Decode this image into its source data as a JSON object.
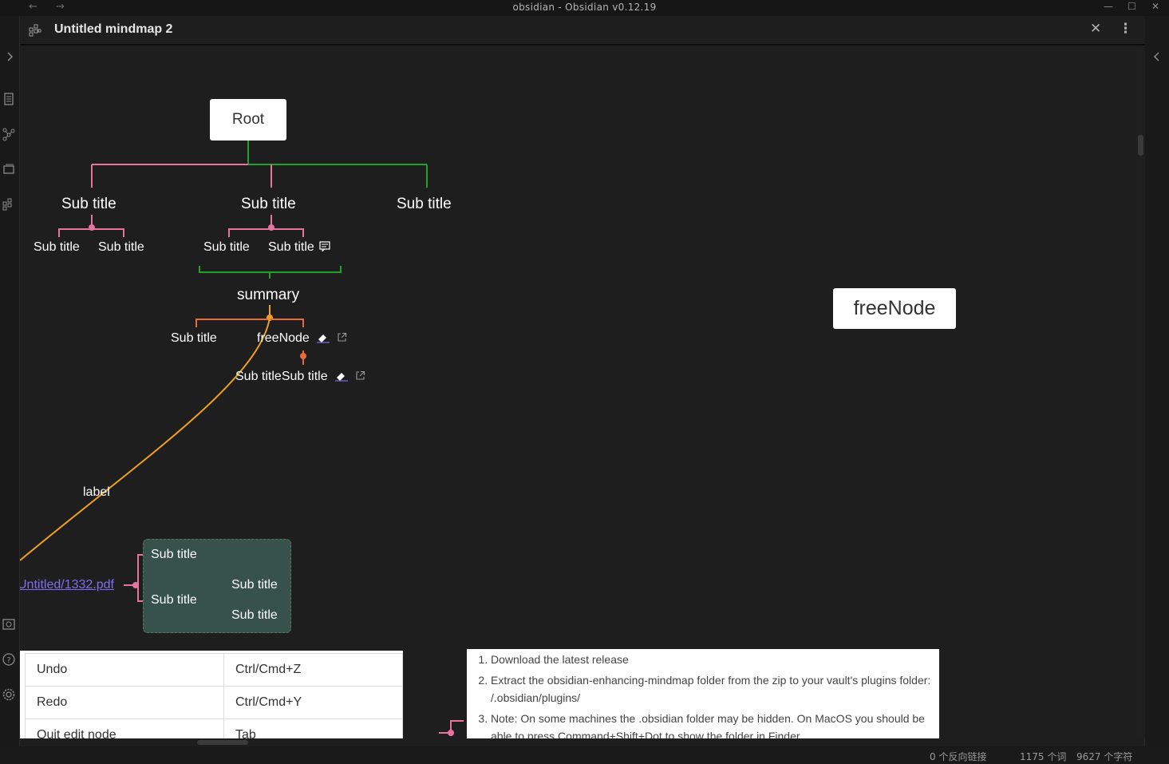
{
  "window": {
    "title": "obsidian - Obsidian v0.12.19",
    "back_glyph": "←",
    "forward_glyph": "→",
    "minimize_glyph": "—",
    "maximize_glyph": "☐",
    "close_glyph": "✕"
  },
  "view": {
    "title": "Untitled mindmap 2",
    "close_glyph": "✕",
    "more_glyph": "⋮"
  },
  "mindmap": {
    "root": "Root",
    "branch_a": {
      "title": "Sub title",
      "children": [
        "Sub title",
        "Sub title"
      ]
    },
    "branch_b": {
      "title": "Sub title",
      "children": [
        "Sub title",
        "Sub title"
      ]
    },
    "branch_c": {
      "title": "Sub title"
    },
    "summary": "summary",
    "summary_children": [
      "Sub title",
      "freeNode"
    ],
    "summary_grandchild": "Sub titleSub title",
    "edge_label": "label",
    "link_node": "Untitled/1332.pdf",
    "group": {
      "top": "Sub title",
      "mid": "Sub title",
      "leaves": [
        "Sub title",
        "Sub title"
      ]
    },
    "free_node": "freeNode"
  },
  "table": {
    "rows": [
      [
        "Undo",
        "Ctrl/Cmd+Z"
      ],
      [
        "Redo",
        "Ctrl/Cmd+Y"
      ],
      [
        "Quit edit node",
        "Tab"
      ]
    ]
  },
  "list": {
    "items": [
      "Download the latest release",
      "Extract the obsidian-enhancing-mindmap folder from the zip to your vault's plugins folder: /.obsidian/plugins/",
      "Note: On some machines the .obsidian folder may be hidden. On MacOS you should be able to press Command+Shift+Dot to show the folder in Finder."
    ]
  },
  "status": {
    "backlinks": "0 个反向链接",
    "words": "1175 个词",
    "chars": "9627 个字符"
  },
  "colors": {
    "pink": "#e8739e",
    "green": "#1fa12c",
    "orange": "#f0a020",
    "red_orange": "#ea6b3a",
    "group_bg": "#36524a"
  }
}
